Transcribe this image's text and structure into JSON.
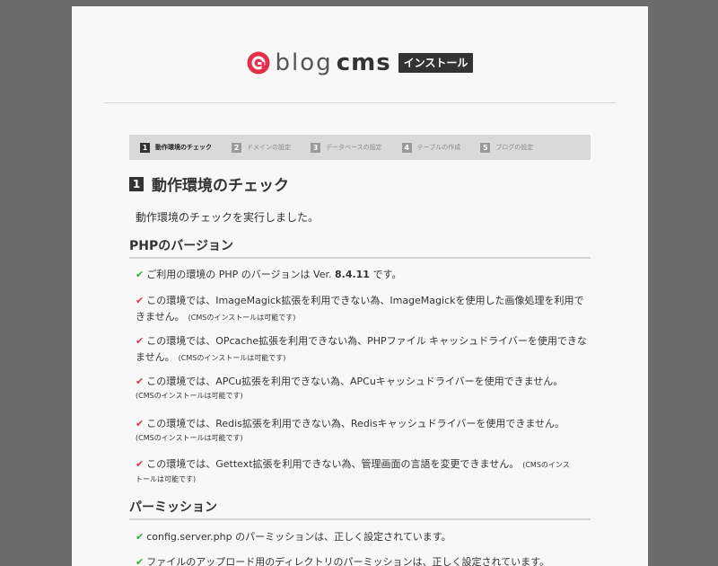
{
  "header": {
    "logo_blog": "blog",
    "logo_cms": "cms",
    "badge": "インストール"
  },
  "steps": [
    {
      "num": "1",
      "label": "動作環境のチェック",
      "active": true
    },
    {
      "num": "2",
      "label": "ドメインの設定",
      "active": false
    },
    {
      "num": "3",
      "label": "データベースの設定",
      "active": false
    },
    {
      "num": "4",
      "label": "テーブルの作成",
      "active": false
    },
    {
      "num": "5",
      "label": "ブログの設定",
      "active": false
    }
  ],
  "section": {
    "num": "1",
    "title": "動作環境のチェック"
  },
  "intro": "動作環境のチェックを実行しました。",
  "php_heading": "PHPのバージョン",
  "php_items": {
    "version": {
      "pre": "ご利用の環境の PHP のバージョンは Ver. ",
      "ver": "8.4.11",
      "post": " です。"
    },
    "imagemagick": {
      "line1": "この環境では、ImageMagick拡張を利用できない為、ImageMagickを使用した画像処理を利用で",
      "line2": "きません。",
      "note": "(CMSのインストールは可能です)"
    },
    "opcache": {
      "line1": "この環境では、OPcache拡張を利用できない為、PHPファイル キャッシュドライバーを使用できな",
      "line2": "ません。",
      "note": "(CMSのインストールは可能です)"
    },
    "apcu": {
      "line1": "この環境では、APCu拡張を利用できない為、APCuキャッシュドライバーを使用できません。",
      "note": "(CMSのインストールは可能です)"
    },
    "redis": {
      "line1": "この環境では、Redis拡張を利用できない為、Redisキャッシュドライバーを使用できません。",
      "note": "(CMSのインストールは可能です)"
    },
    "gettext": {
      "line1": "この環境では、Gettext拡張を利用できない為、管理画面の言語を変更できません。",
      "note1": "(CMSのインス",
      "note2": "トールは可能です)"
    }
  },
  "perm_heading": "パーミッション",
  "perm_items": {
    "config": "config.server.php のパーミッションは、正しく設定されています。",
    "upload": "ファイルのアップロード用のディレクトリのパーミッションは、正しく設定されています。"
  },
  "marks": {
    "ok": "✔",
    "ng": "✔"
  },
  "colors": {
    "ok": "#3aa63a",
    "ng": "#d9364a",
    "logo": "#e4304a"
  }
}
